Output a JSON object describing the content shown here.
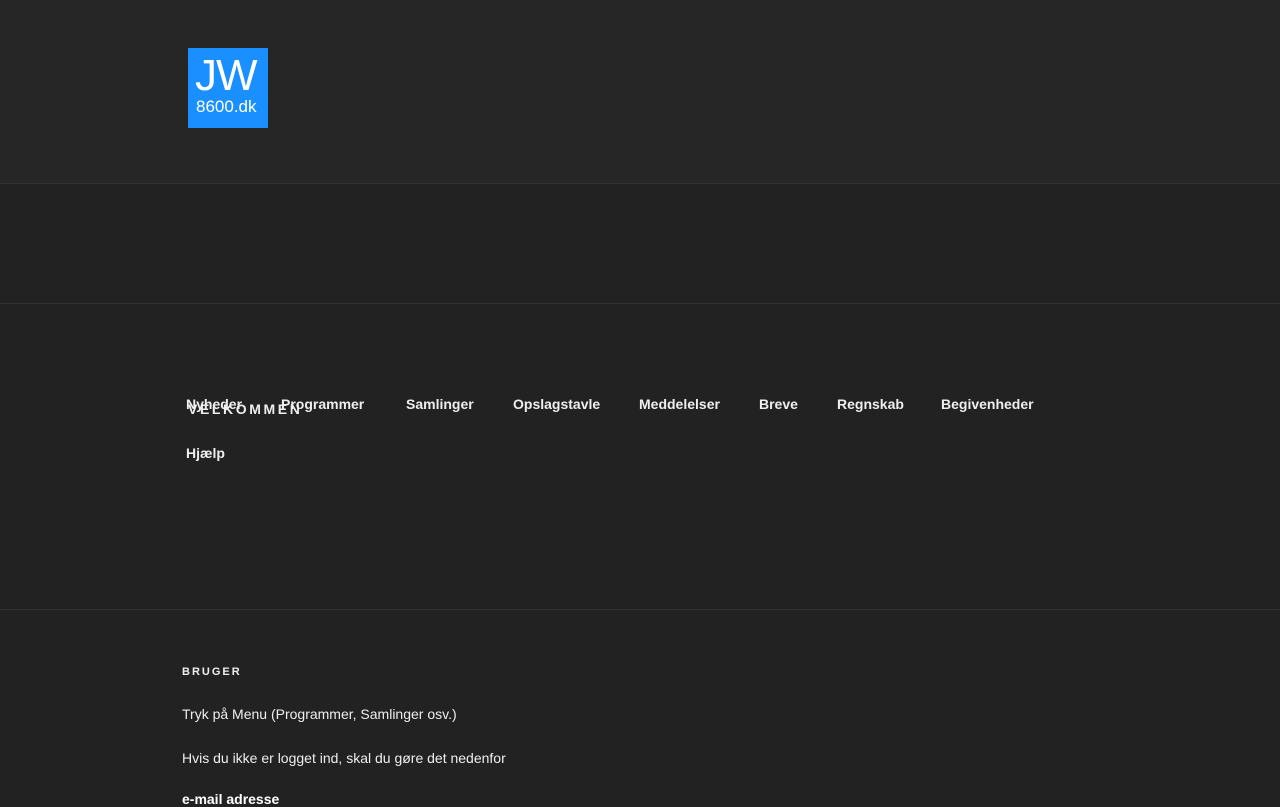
{
  "logo": {
    "main_text": "JW",
    "sub_text": "8600.dk",
    "color": "#1a8fff"
  },
  "nav": {
    "items": [
      {
        "label": "Nyheder"
      },
      {
        "label": "Programmer"
      },
      {
        "label": "Samlinger"
      },
      {
        "label": "Opslagstavle"
      },
      {
        "label": "Meddelelser"
      },
      {
        "label": "Breve"
      },
      {
        "label": "Regnskab"
      },
      {
        "label": "Begivenheder"
      },
      {
        "label": "Hjælp"
      }
    ]
  },
  "main": {
    "title": "VELKOMMEN"
  },
  "footer": {
    "widget_title": "BRUGER",
    "text_1": "Tryk på Menu (Programmer, Samlinger osv.)",
    "text_2": "Hvis du ikke er logget ind, skal du gøre det nedenfor",
    "email_label": "e-mail adresse"
  },
  "colors": {
    "background": "#222222",
    "header_background": "#262626",
    "text": "#eeeeee"
  }
}
